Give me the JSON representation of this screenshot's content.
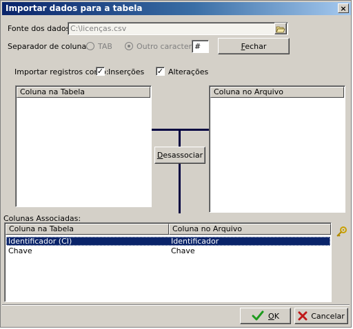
{
  "window": {
    "title": "Importar dados para a tabela",
    "close_symbol": "×"
  },
  "source": {
    "label": "Fonte dos dados:",
    "value": "C:\\licenças.csv"
  },
  "separator": {
    "label": "Separador de colunas:",
    "tab_label": "TAB",
    "other_label": "Outro caractere:",
    "other_value": "#"
  },
  "fechar_button": {
    "label_u": "F",
    "label_rest": "echar"
  },
  "import_as": {
    "label": "Importar registros como:",
    "insercoes_label": "Inserções",
    "alteracoes_label": "Alterações",
    "insercoes_checked": true,
    "alteracoes_checked": true
  },
  "table_list": {
    "header": "Coluna na Tabela"
  },
  "file_list": {
    "header": "Coluna no Arquivo"
  },
  "dissociate_button": {
    "label_u": "D",
    "label_rest": "esassociar"
  },
  "associated": {
    "label": "Colunas Associadas:",
    "columns": [
      "Coluna na Tabela",
      "Coluna no Arquivo"
    ],
    "rows": [
      {
        "table": "Identificador (CI)",
        "file": "Identificador",
        "selected": true
      },
      {
        "table": "Chave",
        "file": "Chave",
        "selected": false
      }
    ]
  },
  "ok_button": {
    "label_u": "O",
    "label_rest": "K"
  },
  "cancel_button": {
    "label": "Cancelar"
  },
  "icons": {
    "browse": "folder-open-icon",
    "key": "key-icon",
    "ok": "checkmark-icon",
    "cancel": "x-icon"
  },
  "colors": {
    "title_start": "#0a246a",
    "title_end": "#a6caf0",
    "selection": "#0a246a",
    "connector": "#000040",
    "ok_green": "#1e9a1e",
    "cancel_red": "#c01818"
  }
}
